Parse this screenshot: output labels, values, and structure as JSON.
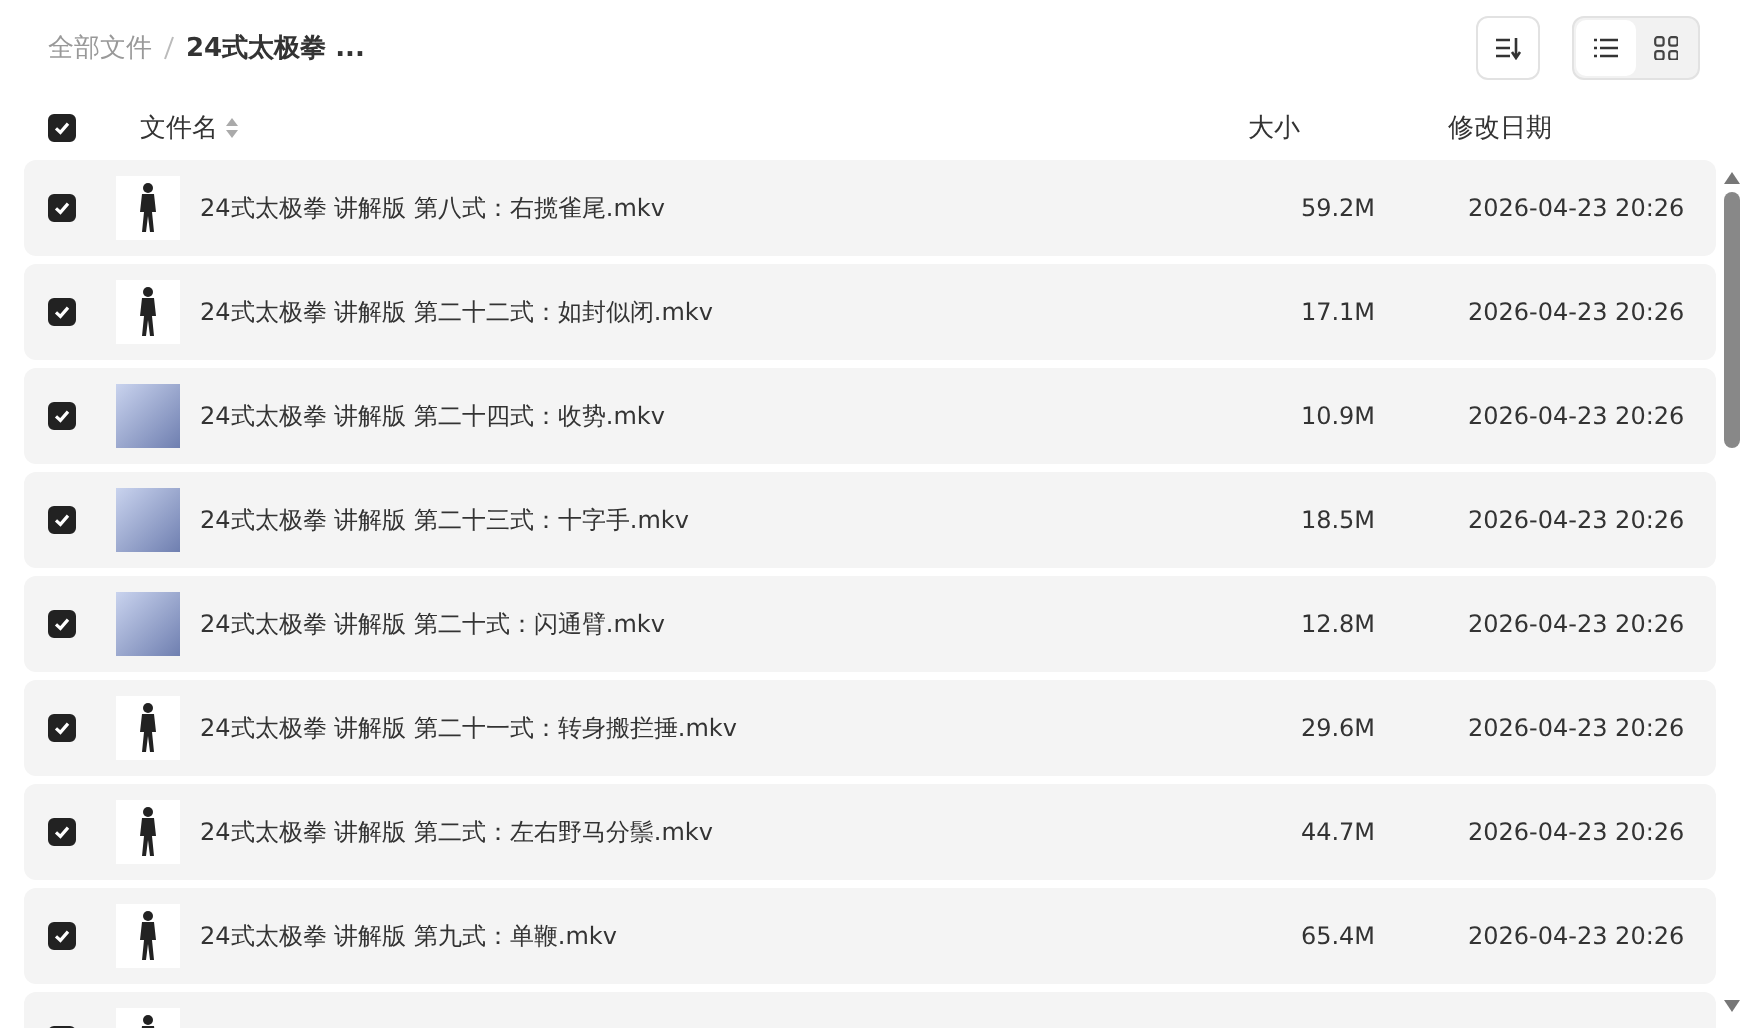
{
  "breadcrumb": [
    {
      "label": "全部文件",
      "current": false
    },
    {
      "label": "24式太极拳 ...",
      "current": true
    }
  ],
  "toolbar": {
    "views": [
      {
        "kind": "list",
        "selected": true
      },
      {
        "kind": "grid",
        "selected": false
      }
    ]
  },
  "columns": {
    "select_all": {
      "checked": true
    },
    "name": "文件名",
    "size": "大小",
    "modified": "修改日期"
  },
  "files": [
    {
      "checked": true,
      "kind": "figure",
      "name": "24式太极拳 讲解版 第八式：右揽雀尾.mkv",
      "size": "59.2M",
      "modified": "2026-04-23 20:26"
    },
    {
      "checked": true,
      "kind": "figure",
      "name": "24式太极拳 讲解版 第二十二式：如封似闭.mkv",
      "size": "17.1M",
      "modified": "2026-04-23 20:26"
    },
    {
      "checked": true,
      "kind": "scenery",
      "name": "24式太极拳 讲解版 第二十四式：收势.mkv",
      "size": "10.9M",
      "modified": "2026-04-23 20:26"
    },
    {
      "checked": true,
      "kind": "scenery",
      "name": "24式太极拳 讲解版 第二十三式：十字手.mkv",
      "size": "18.5M",
      "modified": "2026-04-23 20:26"
    },
    {
      "checked": true,
      "kind": "scenery",
      "name": "24式太极拳 讲解版 第二十式：闪通臂.mkv",
      "size": "12.8M",
      "modified": "2026-04-23 20:26"
    },
    {
      "checked": true,
      "kind": "figure",
      "name": "24式太极拳 讲解版 第二十一式：转身搬拦捶.mkv",
      "size": "29.6M",
      "modified": "2026-04-23 20:26"
    },
    {
      "checked": true,
      "kind": "figure",
      "name": "24式太极拳 讲解版 第二式：左右野马分鬃.mkv",
      "size": "44.7M",
      "modified": "2026-04-23 20:26"
    },
    {
      "checked": true,
      "kind": "figure",
      "name": "24式太极拳 讲解版 第九式：单鞭.mkv",
      "size": "65.4M",
      "modified": "2026-04-23 20:26"
    },
    {
      "checked": true,
      "kind": "figure"
    }
  ]
}
